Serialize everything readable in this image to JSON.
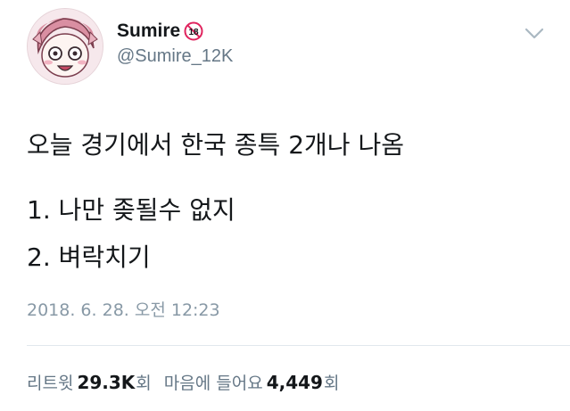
{
  "tweet": {
    "display_name": "Sumire",
    "age_badge": "18",
    "handle": "@Sumire_12K",
    "lines": [
      "오늘 경기에서 한국 종특 2개나 나옴",
      "1. 나만 좆될수 없지",
      "2. 벼락치기"
    ],
    "timestamp": "2018. 6. 28. 오전 12:23"
  },
  "stats": {
    "retweets_label": "리트윗",
    "retweets_count": "29.3K",
    "retweets_unit": "회",
    "likes_label": "마음에 들어요",
    "likes_count": "4,449",
    "likes_unit": "회"
  },
  "colors": {
    "text": "#14171a",
    "secondary": "#657786",
    "timestamp": "#8899a6",
    "badge_red": "#e0245e",
    "divider": "#e1e8ed"
  },
  "icons": {
    "menu": "chevron-down-icon",
    "badge": "age-18-badge-icon"
  }
}
